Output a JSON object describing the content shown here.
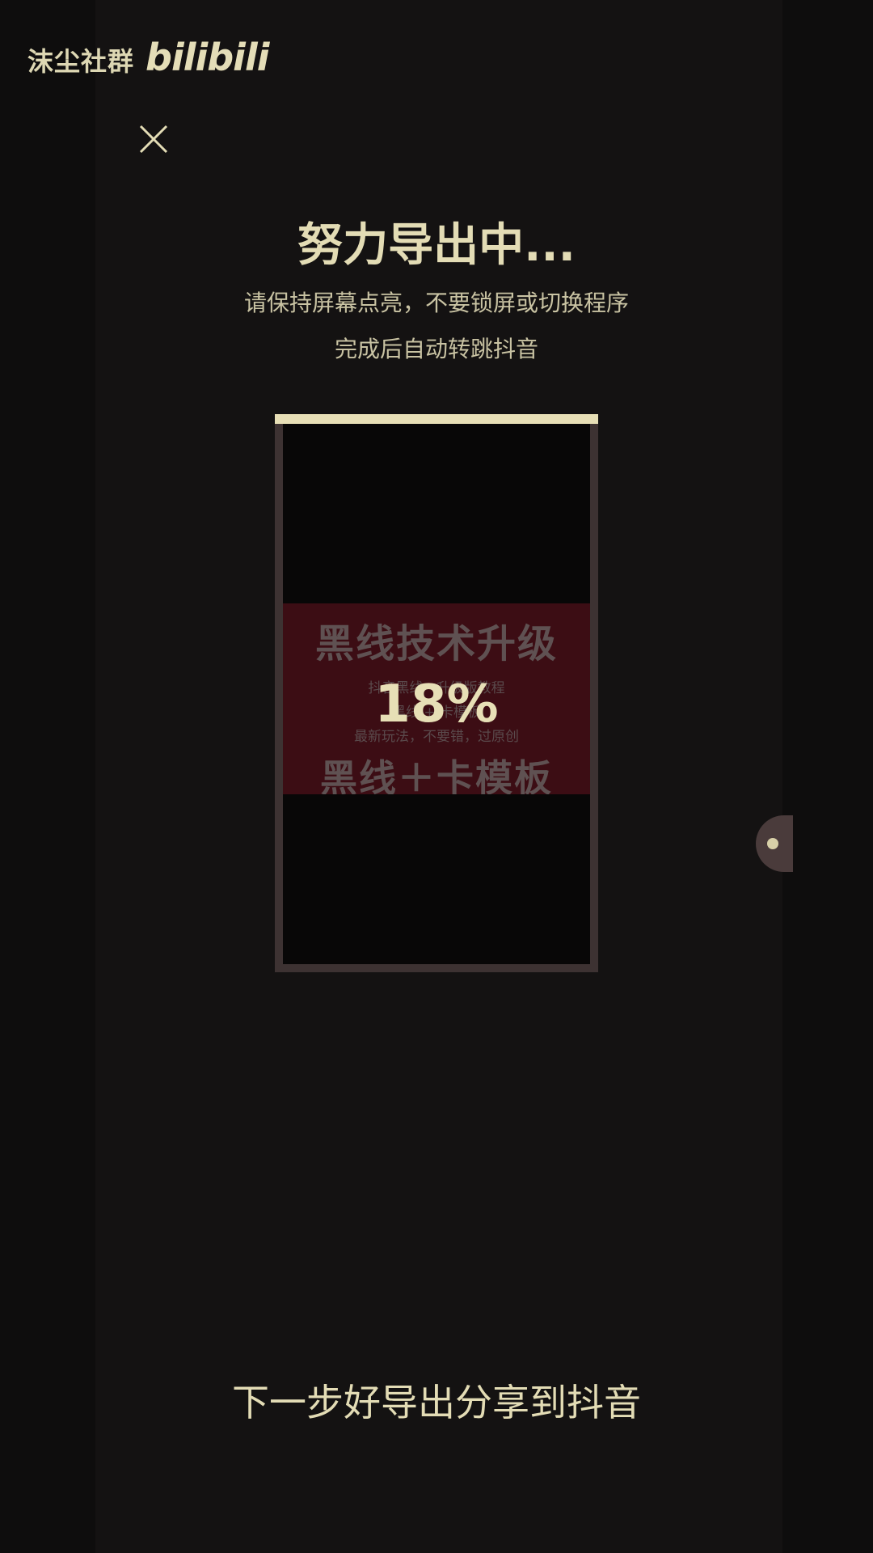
{
  "watermark": {
    "text": "沫尘社群",
    "logo": "bilibili"
  },
  "header": {
    "close_icon": "close-icon"
  },
  "export": {
    "title": "努力导出中...",
    "subtitle_line1": "请保持屏幕点亮，不要锁屏或切换程序",
    "subtitle_line2": "完成后自动转跳抖音",
    "progress_percent_text": "18%",
    "progress_fraction": 0.18
  },
  "preview": {
    "band_title": "黑线技术升级",
    "band_line1": "抖音黑线 ·  升级版教程",
    "band_line2": "黑线 + 卡模板",
    "band_line3": "最新玩法，不要错，过原创",
    "band_bottom": "黑线＋卡模板"
  },
  "actions": {
    "next_step_label": "下一步好导出分享到抖音"
  },
  "colors": {
    "background": "#0e0d0d",
    "accent": "#e7dfb6",
    "frame": "#3d3232",
    "band": "#3c0d14"
  }
}
